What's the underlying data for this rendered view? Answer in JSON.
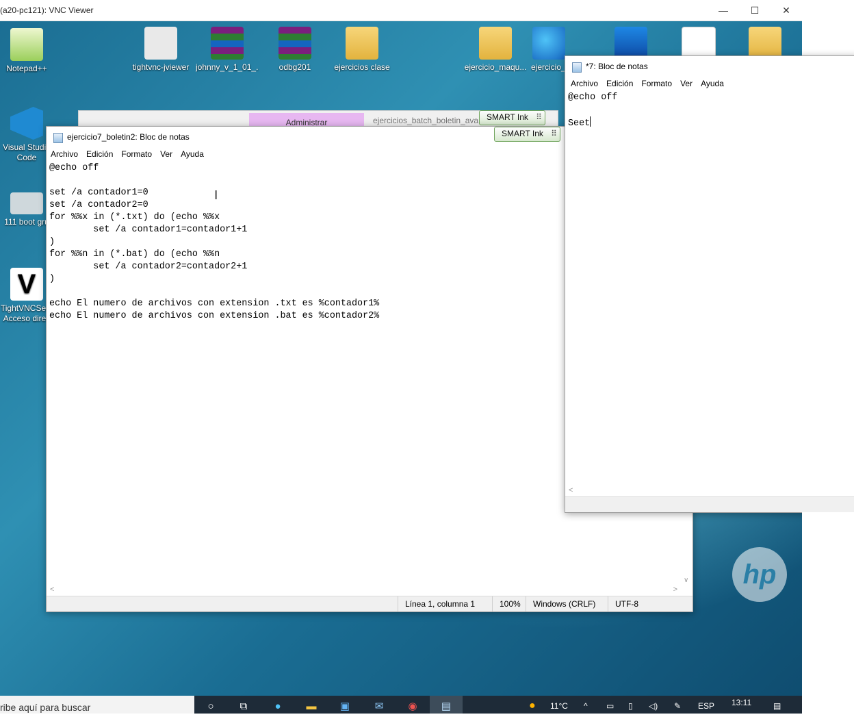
{
  "vnc": {
    "title": "(a20-pc121): VNC Viewer",
    "minimize": "—",
    "maximize": "☐",
    "close": "✕"
  },
  "desktop_icons": [
    {
      "label": "Notepad++",
      "icon": "notepad-plus-plus-icon"
    },
    {
      "label": "tightvnc-jviewer",
      "icon": "java-icon"
    },
    {
      "label": "johnny_v_1_01_...",
      "icon": "winrar-icon"
    },
    {
      "label": "odbg201",
      "icon": "winrar-icon"
    },
    {
      "label": "ejercicios clase",
      "icon": "folder-icon"
    },
    {
      "label": "ejercicio_maqu...",
      "icon": "folder-icon"
    },
    {
      "label": "ejercicio_",
      "icon": "edge-icon"
    },
    {
      "label": "Visual Studio Code",
      "icon": "vscode-icon"
    },
    {
      "label": "111 boot gru",
      "icon": "gear-icon"
    },
    {
      "label": "TightVNCServ Acceso direc",
      "icon": "tightvnc-icon"
    }
  ],
  "background": {
    "admin_tab": "Administrar",
    "explorer_path": "ejercicios_batch_boletin_avan",
    "smart_ink_label": "SMART Ink"
  },
  "notepad_main": {
    "title": "ejercicio7_boletin2: Bloc de notas",
    "menu": [
      "Archivo",
      "Edición",
      "Formato",
      "Ver",
      "Ayuda"
    ],
    "content": "@echo off\n\nset /a contador1=0\nset /a contador2=0\nfor %%x in (*.txt) do (echo %%x\n        set /a contador1=contador1+1\n)\nfor %%n in (*.bat) do (echo %%n\n        set /a contador2=contador2+1\n)\n\necho El numero de archivos con extension .txt es %contador1%\necho El numero de archivos con extension .bat es %contador2%",
    "status": {
      "position": "Línea 1, columna 1",
      "zoom": "100%",
      "line_endings": "Windows (CRLF)",
      "encoding": "UTF-8"
    }
  },
  "notepad_second": {
    "title": "*7: Bloc de notas",
    "menu": [
      "Archivo",
      "Edición",
      "Formato",
      "Ver",
      "Ayuda"
    ],
    "line1": "@echo off",
    "line2": "Seet"
  },
  "taskbar": {
    "search_placeholder": "ribe aquí para buscar",
    "weather": "11°C",
    "language": "ESP",
    "time": "13:11",
    "apps": [
      "search-icon",
      "task-view-icon",
      "edge-icon",
      "file-explorer-icon",
      "store-icon",
      "mail-icon",
      "chrome-icon",
      "notepad-icon"
    ]
  }
}
